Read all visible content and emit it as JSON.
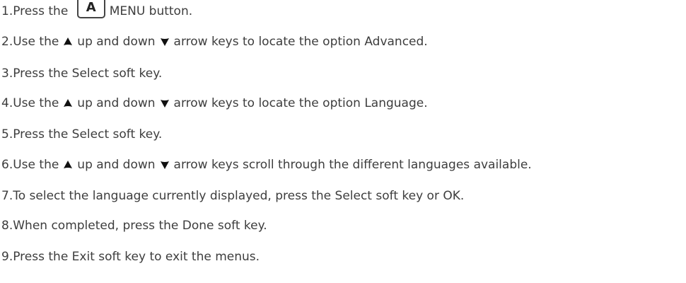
{
  "steps": [
    {
      "num": "1.",
      "parts": [
        {
          "t": "text",
          "v": "Press the "
        },
        {
          "t": "key",
          "v": "A",
          "name": "menu-key-icon"
        },
        {
          "t": "text",
          "v": "MENU button."
        }
      ]
    },
    {
      "num": "2.",
      "parts": [
        {
          "t": "text",
          "v": "Use the"
        },
        {
          "t": "up",
          "name": "up-arrow-icon"
        },
        {
          "t": "text",
          "v": "up and down"
        },
        {
          "t": "down",
          "name": "down-arrow-icon"
        },
        {
          "t": "text",
          "v": "arrow keys to locate the option Advanced."
        }
      ]
    },
    {
      "num": "3.",
      "parts": [
        {
          "t": "text",
          "v": "Press the Select soft key."
        }
      ]
    },
    {
      "num": "4.",
      "parts": [
        {
          "t": "text",
          "v": "Use the"
        },
        {
          "t": "up",
          "name": "up-arrow-icon"
        },
        {
          "t": "text",
          "v": "up and down"
        },
        {
          "t": "down",
          "name": "down-arrow-icon"
        },
        {
          "t": "text",
          "v": "arrow keys to locate the option Language."
        }
      ]
    },
    {
      "num": "5.",
      "parts": [
        {
          "t": "text",
          "v": "Press the Select soft key."
        }
      ]
    },
    {
      "num": "6.",
      "parts": [
        {
          "t": "text",
          "v": "Use the"
        },
        {
          "t": "up",
          "name": "up-arrow-icon"
        },
        {
          "t": "text",
          "v": "up and down"
        },
        {
          "t": "down",
          "name": "down-arrow-icon"
        },
        {
          "t": "text",
          "v": "arrow keys scroll through the different languages available."
        }
      ]
    },
    {
      "num": "7.",
      "parts": [
        {
          "t": "text",
          "v": "To select the language currently displayed, press the Select soft key or OK."
        }
      ]
    },
    {
      "num": "8.",
      "parts": [
        {
          "t": "text",
          "v": "When completed, press the Done soft key."
        }
      ]
    },
    {
      "num": "9.",
      "parts": [
        {
          "t": "text",
          "v": "Press the Exit soft key to exit the menus."
        }
      ]
    }
  ]
}
